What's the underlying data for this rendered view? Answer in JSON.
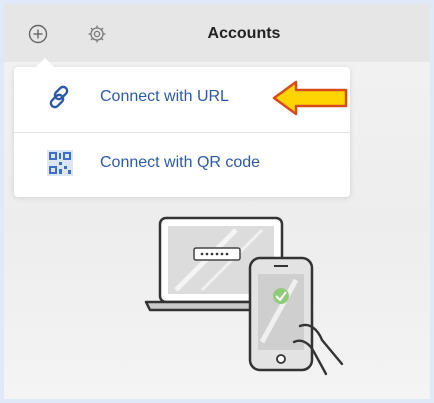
{
  "header": {
    "title": "Accounts",
    "add_icon": "plus-circle-icon",
    "settings_icon": "gear-icon"
  },
  "menu": {
    "items": [
      {
        "label": "Connect with URL",
        "icon": "link-icon"
      },
      {
        "label": "Connect with QR code",
        "icon": "qr-code-icon"
      }
    ]
  },
  "annotation": {
    "icon": "yellow-arrow-left",
    "color": "#ffd400"
  },
  "colors": {
    "accent": "#2c5aa9",
    "header_bg": "#e6e6e6",
    "page_bg": "#f0f0f0"
  }
}
